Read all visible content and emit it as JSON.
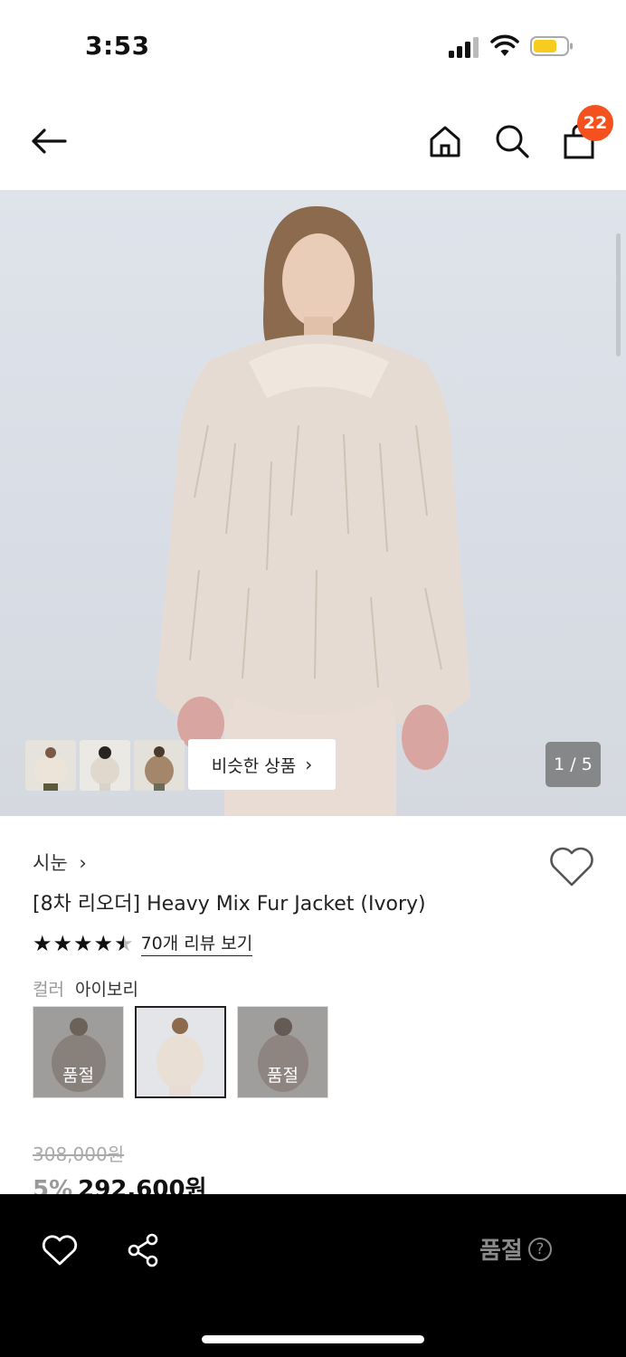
{
  "status_bar": {
    "time": "3:53"
  },
  "header": {
    "back_icon": "arrow-left-icon",
    "home_icon": "home-icon",
    "search_icon": "search-icon",
    "bag_icon": "shopping-bag-icon",
    "cart_count": "22",
    "badge_color": "#f4511e"
  },
  "hero": {
    "similar_label": "비슷한 상품",
    "similar_chevron": "›",
    "page_counter": "1 / 5"
  },
  "product": {
    "brand": "시눈",
    "brand_chevron": "›",
    "title": "[8차 리오더] Heavy Mix Fur Jacket (Ivory)",
    "rating": 4.5,
    "review_link": "70개 리뷰 보기",
    "color_label": "컬러",
    "color_value": "아이보리",
    "swatches": [
      {
        "label": "품절",
        "sold_out": true
      },
      {
        "label": "",
        "sold_out": false,
        "selected": true
      },
      {
        "label": "품절",
        "sold_out": true
      }
    ],
    "original_price": "308,000원",
    "discount": "5%",
    "sale_price": "292,600원"
  },
  "bottom_bar": {
    "wish_icon": "heart-icon",
    "share_icon": "share-icon",
    "cta_label": "품절",
    "help_glyph": "?"
  }
}
